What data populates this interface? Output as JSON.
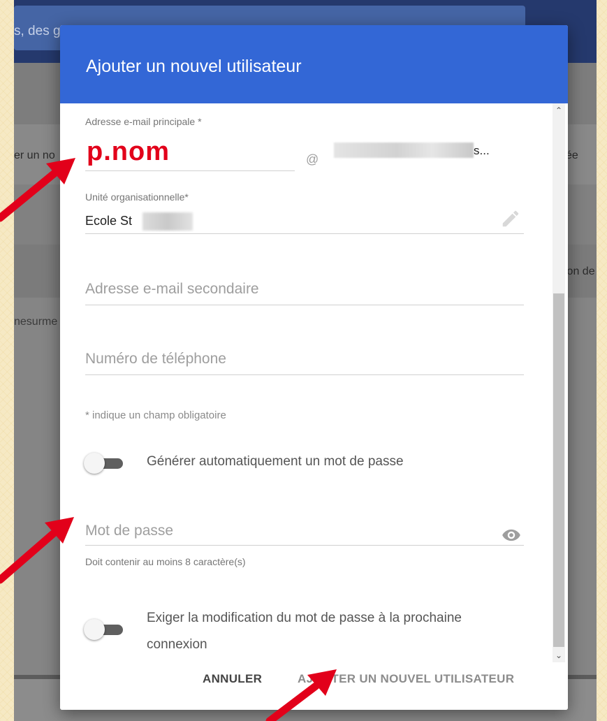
{
  "background": {
    "search_text": "s, des groupes ou des paramètres",
    "left_text_1": "er un no",
    "right_text_1": "ée",
    "right_text_2": "ion de",
    "left_text_2": "nesurme"
  },
  "dialog": {
    "title": "Ajouter un nouvel utilisateur",
    "primary_email": {
      "label": "Adresse e-mail principale *",
      "value": "p.nom",
      "at": "@",
      "domain_suffix": "s..."
    },
    "org_unit": {
      "label": "Unité organisationnelle*",
      "value": "Ecole St"
    },
    "secondary_email": {
      "placeholder": "Adresse e-mail secondaire"
    },
    "phone": {
      "placeholder": "Numéro de téléphone"
    },
    "required_note": "* indique un champ obligatoire",
    "auto_password": {
      "label": "Générer automatiquement un mot de passe",
      "enabled": false
    },
    "password": {
      "placeholder": "Mot de passe",
      "hint": "Doit contenir au moins 8 caractère(s)"
    },
    "require_change": {
      "label": "Exiger la modification du mot de passe à la prochaine connexion",
      "enabled": false
    },
    "footer": {
      "cancel_label": "ANNULER",
      "add_label": "AJOUTER UN NOUVEL UTILISATEUR"
    }
  },
  "colors": {
    "header": "#3367d6",
    "annotation_arrow": "#e2001a",
    "email_value": "#e2001a"
  }
}
